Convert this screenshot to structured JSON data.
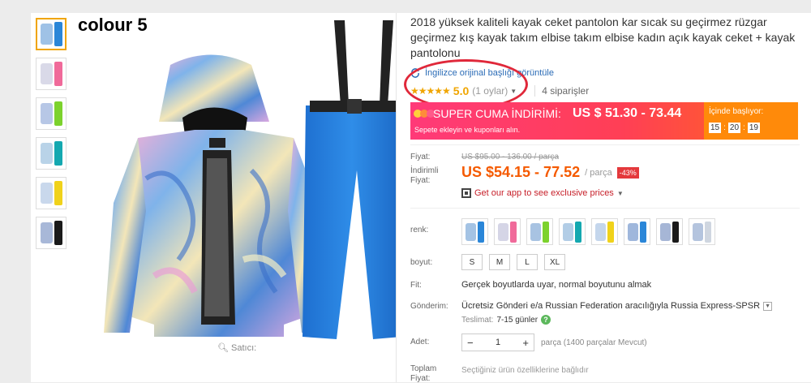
{
  "colour_label": "colour 5",
  "gallery": {
    "seller_label": "Satıcı:",
    "thumbnails": [
      {
        "jacket": "#9fc2e6",
        "pants": "#2a86d8"
      },
      {
        "jacket": "#d9d9e8",
        "pants": "#f06a9a"
      },
      {
        "jacket": "#b7c7e6",
        "pants": "#7cd22d"
      },
      {
        "jacket": "#b9d3e8",
        "pants": "#14a8b0"
      },
      {
        "jacket": "#c9d8ec",
        "pants": "#f0d21b"
      },
      {
        "jacket": "#a8b8d8",
        "pants": "#1a1a1a"
      }
    ],
    "active_index": 0
  },
  "product": {
    "title": "2018 yüksek kaliteli kayak ceket pantolon kar sıcak su geçirmez rüzgar geçirmez kış kayak takım elbise takım elbise kadın açık kayak ceket + kayak pantolonu",
    "translate_link": "İngilizce orijinal başlığı görüntüle",
    "stars": "★★★★★",
    "rating": "5.0",
    "votes": "(1 oylar)",
    "orders": "4 siparişler"
  },
  "promo": {
    "name": "SUPER CUMA İNDİRİMİ:",
    "price": "US $ 51.30 - 73.44",
    "sub": "Sepete ekleyin ve kuponları alın.",
    "timer_label": "İçinde başlıyor:",
    "timer": [
      "15",
      "20",
      "19"
    ]
  },
  "pricing": {
    "price_label": "Fiyat:",
    "old_price": "US $95.00 - 136.00 / parça",
    "discount_label_line1": "İndirimli",
    "discount_label_line2": "Fiyat:",
    "new_price": "US $54.15 - 77.52",
    "per_unit": "/ parça",
    "discount_badge": "-43%",
    "app_text": "Get our app to see exclusive prices"
  },
  "options": {
    "color_label": "renk:",
    "color_swatches": [
      {
        "jacket": "#a4c3e4",
        "pants": "#2a86d8"
      },
      {
        "jacket": "#d5d5e6",
        "pants": "#f06a9a"
      },
      {
        "jacket": "#a8c3e2",
        "pants": "#7cd22d"
      },
      {
        "jacket": "#b2cde6",
        "pants": "#14a8b0"
      },
      {
        "jacket": "#c4d6ec",
        "pants": "#f0d21b"
      },
      {
        "jacket": "#9fb7dc",
        "pants": "#2a86d8"
      },
      {
        "jacket": "#a6b6d6",
        "pants": "#1a1a1a"
      },
      {
        "jacket": "#b4c4de",
        "pants": "#cfd6e0"
      }
    ],
    "size_label": "boyut:",
    "sizes": [
      "S",
      "M",
      "L",
      "XL"
    ],
    "fit_label": "Fit:",
    "fit_text": "Gerçek boyutlarda uyar, normal boyutunu almak",
    "shipping_label": "Gönderim:",
    "shipping_text": "Ücretsiz Gönderi e/a Russian Federation aracılığıyla Russia Express-SPSR",
    "delivery_label": "Teslimat:",
    "delivery_value": "7-15 günler",
    "qty_label": "Adet:",
    "qty_minus": "−",
    "qty_value": "1",
    "qty_plus": "+",
    "qty_note": "parça (1400 parçalar Mevcut)",
    "total_label_line1": "Toplam",
    "total_label_line2": "Fiyat:",
    "total_note": "Seçtiğiniz ürün özelliklerine bağlıdır"
  },
  "colors": {
    "accent_orange": "#f55a00",
    "discount_red": "#e4393c",
    "highlight_circle": "#e0283a",
    "link_blue": "#2a6bb6",
    "star_gold": "#f0a500"
  }
}
